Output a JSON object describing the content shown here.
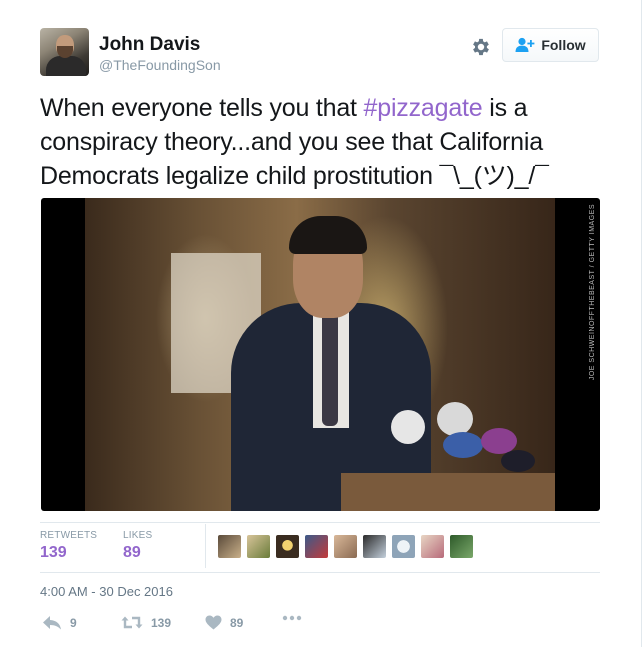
{
  "user": {
    "display_name": "John Davis",
    "screen_name": "@TheFoundingSon"
  },
  "follow_button": {
    "label": "Follow",
    "icon": "add-user-icon"
  },
  "settings_icon": "gear-icon",
  "tweet": {
    "text_before": "When everyone tells you that ",
    "hashtag": "#pizzagate",
    "text_after": " is a conspiracy theory...and you see that California Democrats legalize child prostitution ¯\\_(ツ)_/¯"
  },
  "photo": {
    "watermark": "JOE SCHWEINOFFTHEBEAST / GETTY IMAGES"
  },
  "stats": {
    "retweets_label": "RETWEETS",
    "retweets_value": "139",
    "likes_label": "LIKES",
    "likes_value": "89"
  },
  "timestamp": "4:00 AM - 30 Dec 2016",
  "actions": {
    "reply_count": "9",
    "retweet_count": "139",
    "like_count": "89",
    "more_icon": "more-icon"
  },
  "colors": {
    "hashtag": "#9266cc",
    "stat_value": "#9266cc",
    "muted": "#8899a6"
  }
}
